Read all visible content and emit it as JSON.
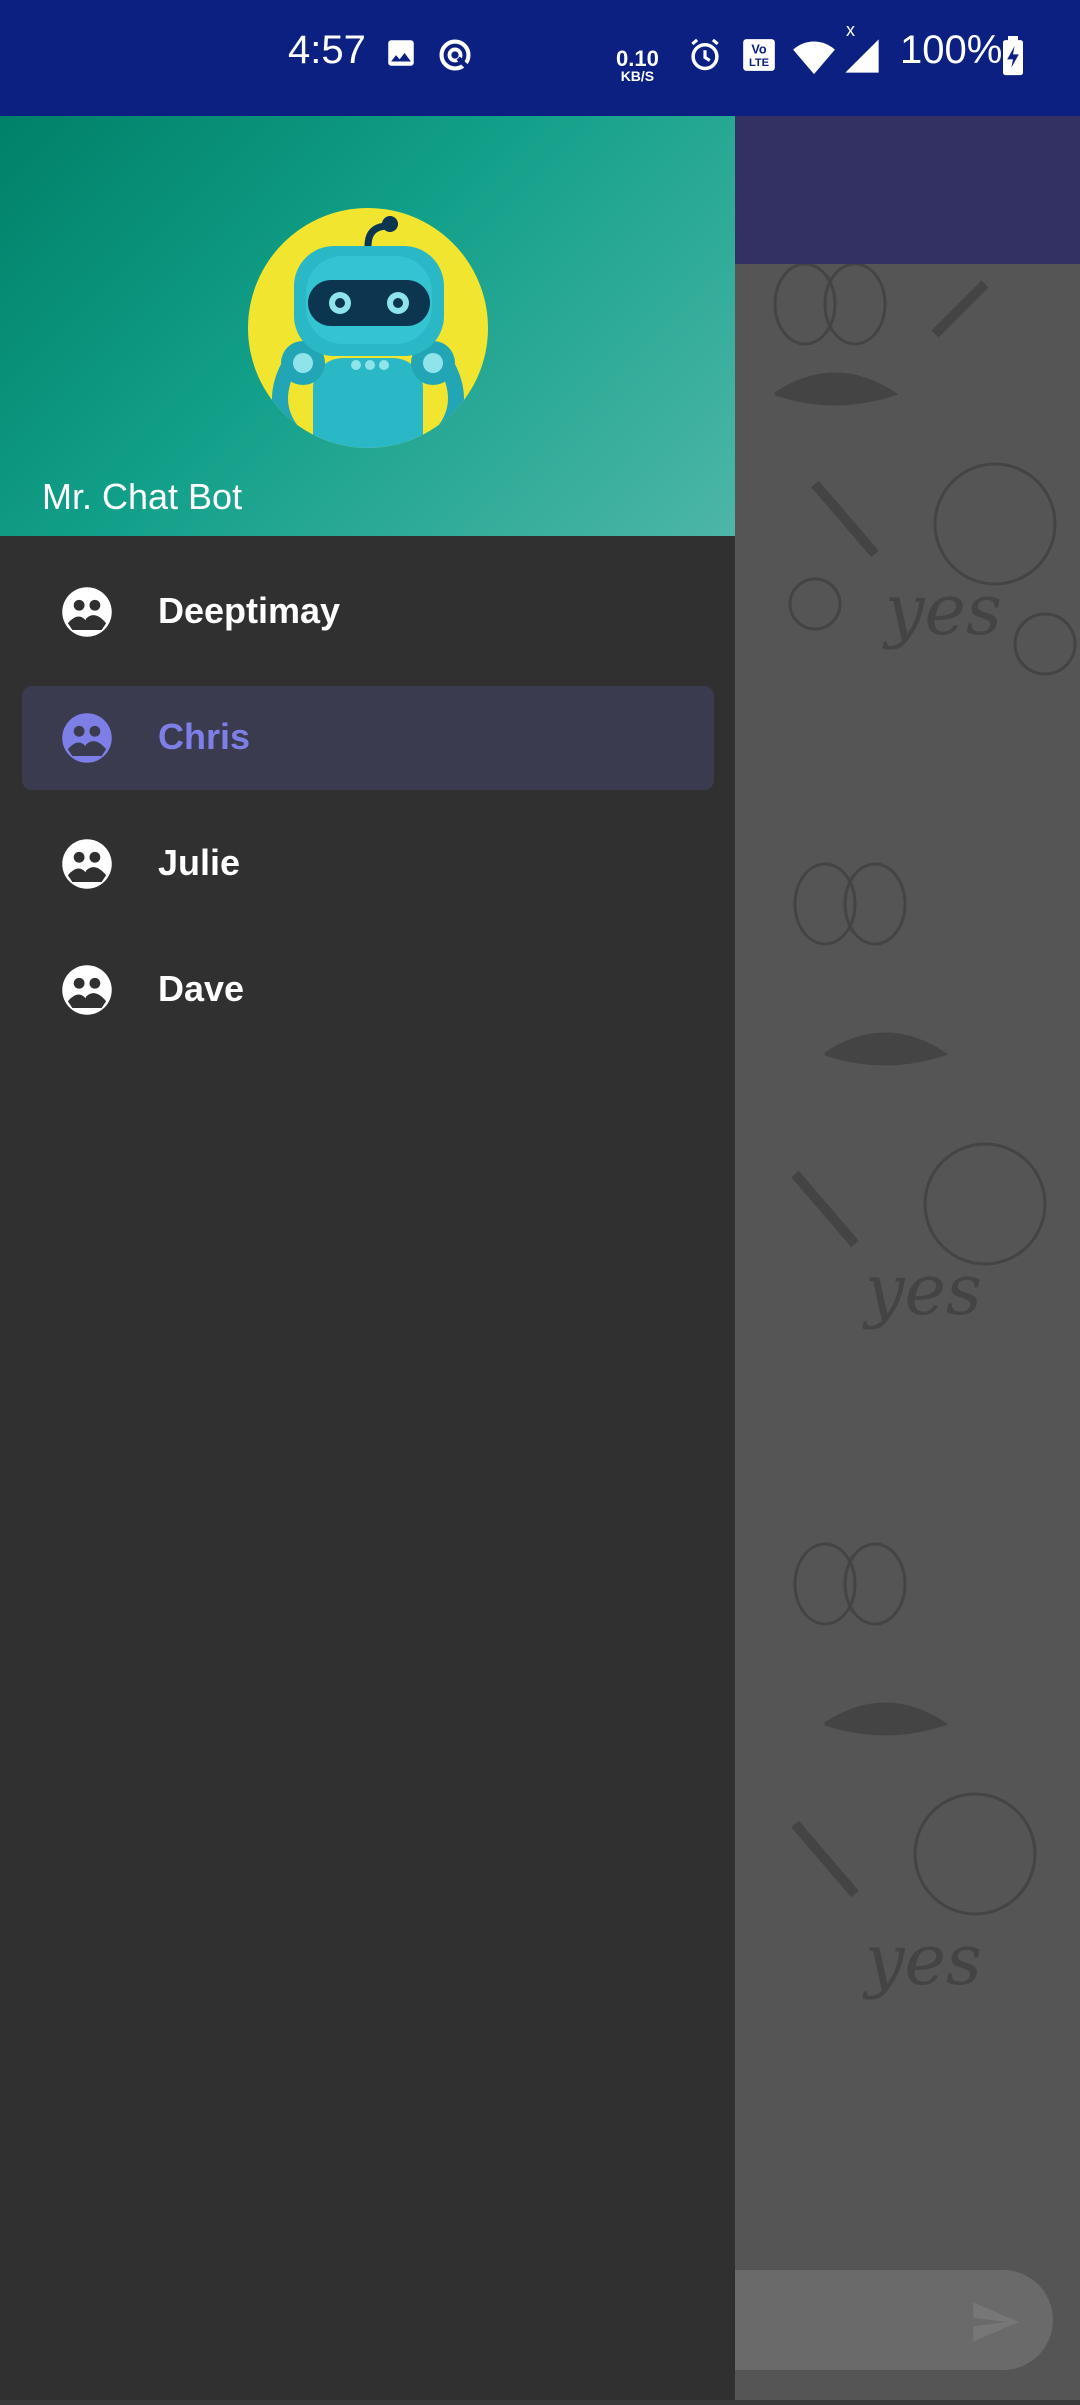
{
  "status_bar": {
    "time": "4:57",
    "network_speed_value": "0.10",
    "network_speed_unit": "KB/S",
    "battery": "100%",
    "icons": [
      "image-icon",
      "data-saver-icon",
      "alarm-icon",
      "volte-icon",
      "wifi-icon",
      "signal-icon",
      "battery-charging-icon"
    ]
  },
  "drawer": {
    "profile_name": "Mr. Chat Bot",
    "items": [
      {
        "label": "Deeptimay",
        "icon": "group-icon",
        "selected": false
      },
      {
        "label": "Chris",
        "icon": "group-icon",
        "selected": true
      },
      {
        "label": "Julie",
        "icon": "group-icon",
        "selected": false
      },
      {
        "label": "Dave",
        "icon": "group-icon",
        "selected": false
      }
    ]
  },
  "colors": {
    "status_bar": "#0b2080",
    "header_gradient_start": "#008068",
    "header_gradient_end": "#4db6a8",
    "drawer_background": "#303030",
    "selected_item_background": "#3b3b4f",
    "selected_accent": "#7d7fe6",
    "toolbar": "#333063"
  }
}
